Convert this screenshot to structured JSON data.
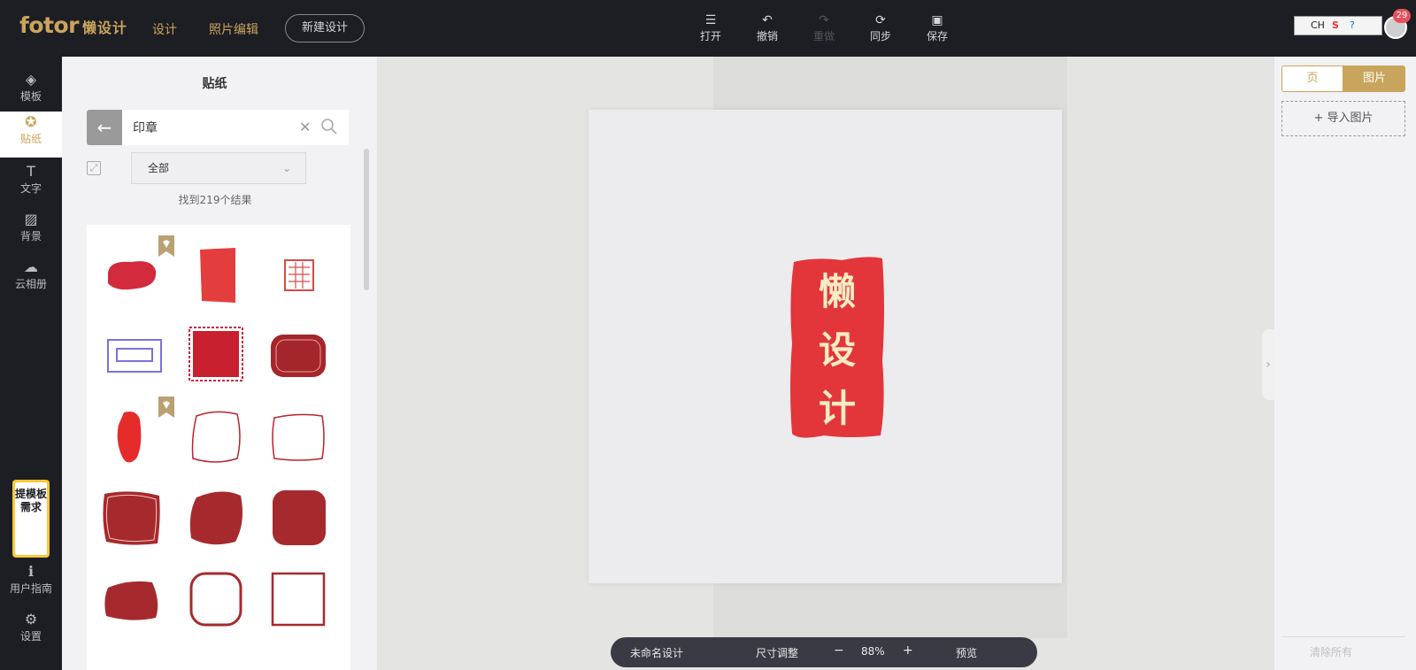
{
  "header": {
    "logo_text": "fotor",
    "logo_sub": "懒设计",
    "nav": [
      "设计",
      "照片编辑"
    ],
    "new_design": "新建设计",
    "tools": [
      {
        "label": "打开",
        "icon": "menu-icon",
        "glyph": "☰",
        "enabled": true
      },
      {
        "label": "撤销",
        "icon": "undo-icon",
        "glyph": "↶",
        "enabled": true
      },
      {
        "label": "重做",
        "icon": "redo-icon",
        "glyph": "↷",
        "enabled": false
      },
      {
        "label": "同步",
        "icon": "sync-icon",
        "glyph": "⟳",
        "enabled": true
      },
      {
        "label": "保存",
        "icon": "save-icon",
        "glyph": "▣",
        "enabled": true
      }
    ],
    "tray": {
      "lang": "CH",
      "s_logo": "S"
    },
    "notification_count": "29"
  },
  "sidebar": {
    "items": [
      {
        "label": "模板",
        "icon": "layers-icon",
        "glyph": "◈"
      },
      {
        "label": "贴纸",
        "icon": "sticker-icon",
        "glyph": "✪"
      },
      {
        "label": "文字",
        "icon": "text-icon",
        "glyph": "T"
      },
      {
        "label": "背景",
        "icon": "background-icon",
        "glyph": "▨"
      },
      {
        "label": "云相册",
        "icon": "cloud-upload-icon",
        "glyph": "☁"
      }
    ],
    "active_index": 1,
    "request_badge": "提模板需求",
    "guide": {
      "label": "用户指南",
      "icon": "info-icon",
      "glyph": "ℹ"
    },
    "settings": {
      "label": "设置",
      "icon": "gear-icon",
      "glyph": "⚙"
    }
  },
  "sticker_panel": {
    "title": "贴纸",
    "search_value": "印章",
    "filter_value": "全部",
    "result_text": "找到219个结果"
  },
  "canvas": {
    "seal_chars": [
      "懒",
      "设",
      "计"
    ],
    "seal_color": "#e2363a",
    "seal_text_color": "#f7ecc4"
  },
  "statusbar": {
    "design_name": "未命名设计",
    "resize": "尺寸调整",
    "zoom_out": "−",
    "zoom": "88%",
    "zoom_in": "+",
    "preview": "预览"
  },
  "right_panel": {
    "tab_page": "页",
    "tab_image": "图片",
    "import": "+ 导入图片",
    "clear_all": "清除所有"
  },
  "colors": {
    "accent": "#c9a45c",
    "dark_bg": "#1d1d24",
    "seal_red": "#c8232c"
  }
}
